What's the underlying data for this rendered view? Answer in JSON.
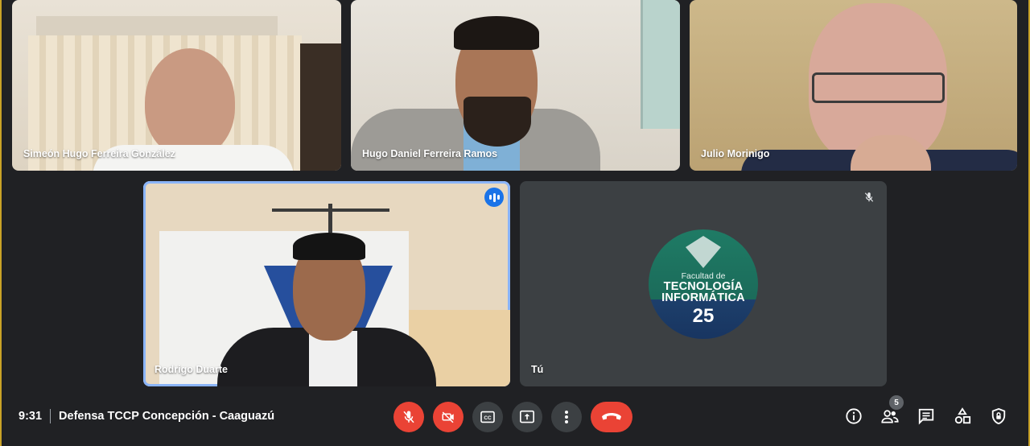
{
  "participants": [
    {
      "name": "Simeón Hugo Ferreira González"
    },
    {
      "name": "Hugo Daniel Ferreira Ramos"
    },
    {
      "name": "Julio Morinigo"
    },
    {
      "name": "Rodrigo Duarte"
    },
    {
      "name": "Tú"
    }
  ],
  "self_avatar": {
    "line1": "Facultad de",
    "line2": "TECNOLOGÍA",
    "line3": "INFORMÁTICA",
    "line4": "25"
  },
  "meeting": {
    "time": "9:31",
    "title": "Defensa TCCP Concepción - Caaguazú"
  },
  "controls": [
    {
      "icon": "mic-off-icon"
    },
    {
      "icon": "camera-off-icon"
    },
    {
      "icon": "captions-icon"
    },
    {
      "icon": "present-icon"
    },
    {
      "icon": "more-options-icon"
    },
    {
      "icon": "hang-up-icon"
    }
  ],
  "right_panel": {
    "people_count": "5",
    "icons": [
      "info-icon",
      "people-icon",
      "chat-icon",
      "activities-icon",
      "host-controls-icon"
    ]
  },
  "colors": {
    "background": "#202124",
    "tile": "#3c4043",
    "active_speaker": "#8ab4f8",
    "danger": "#ea4335",
    "speaking_indicator": "#1a73e8"
  }
}
